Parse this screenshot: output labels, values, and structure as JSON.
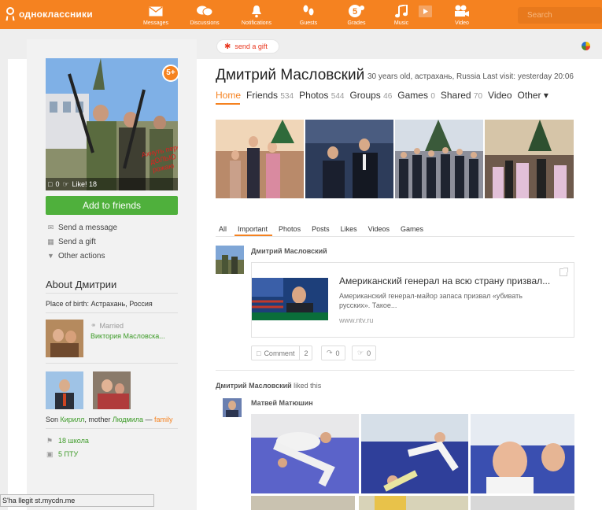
{
  "brand": {
    "name": "одноклассники"
  },
  "nav": [
    {
      "label": "Messages",
      "icon": "envelope-icon"
    },
    {
      "label": "Discussions",
      "icon": "chat-bubbles-icon"
    },
    {
      "label": "Notifications",
      "icon": "bell-icon"
    },
    {
      "label": "Guests",
      "icon": "footprints-icon"
    },
    {
      "label": "Grades",
      "icon": "grade-5-icon"
    },
    {
      "label": "Music",
      "icon": "music-note-icon"
    },
    {
      "label": "Video",
      "icon": "video-camera-icon"
    }
  ],
  "search": {
    "placeholder": "Search"
  },
  "gift_button": {
    "label": "send a gift"
  },
  "profile": {
    "name": "Дмитрий Масловский",
    "meta": "30 years old, астрахань, Russia  Last visit: yesterday 20:06",
    "age_badge": "5+",
    "photo_comments": "0",
    "photo_likes": "Like! 18",
    "photo_caption": "Ахнуть перед дОЛЬЮ рожаю",
    "add_friend": "Add to friends"
  },
  "actions": [
    {
      "label": "Send a message",
      "icon": "envelope-icon"
    },
    {
      "label": "Send a gift",
      "icon": "gift-icon"
    },
    {
      "label": "Other actions",
      "icon": "triangle-down-icon"
    }
  ],
  "about": {
    "title": "About Дмитрии",
    "place_of_birth": "Place of birth: Астрахань, Россия",
    "married_label": "Married",
    "spouse": "Виктория Масловска...",
    "family": {
      "prefix": "Son ",
      "son": "Кирилл",
      "mid": ", mother ",
      "mother": "Людмила",
      "dash": " — ",
      "tag": "family"
    },
    "schools": [
      "18 школа",
      "5 ПТУ"
    ]
  },
  "tabs": [
    {
      "label": "Home",
      "count": ""
    },
    {
      "label": "Friends",
      "count": "534"
    },
    {
      "label": "Photos",
      "count": "544"
    },
    {
      "label": "Groups",
      "count": "46"
    },
    {
      "label": "Games",
      "count": "0"
    },
    {
      "label": "Shared",
      "count": "70"
    },
    {
      "label": "Video",
      "count": ""
    },
    {
      "label": "Other ▾",
      "count": ""
    }
  ],
  "feed_tabs": [
    "All",
    "Important",
    "Photos",
    "Posts",
    "Likes",
    "Videos",
    "Games"
  ],
  "post": {
    "author": "Дмитрий Масловский",
    "link_title": "Американский генерал на всю страну призвал...",
    "link_desc": "Американский генерал-майор запаса призвал «убивать русских». Такое...",
    "link_source": "www.ntv.ru",
    "comment_label": "Comment",
    "comment_count": "2",
    "share_count": "0",
    "like_count": "0"
  },
  "liked_item": {
    "actor": "Дмитрий Масловский",
    "suffix": " liked this",
    "author": "Матвей Матюшин"
  },
  "status_bar": "S'ha llegit st.mycdn.me"
}
